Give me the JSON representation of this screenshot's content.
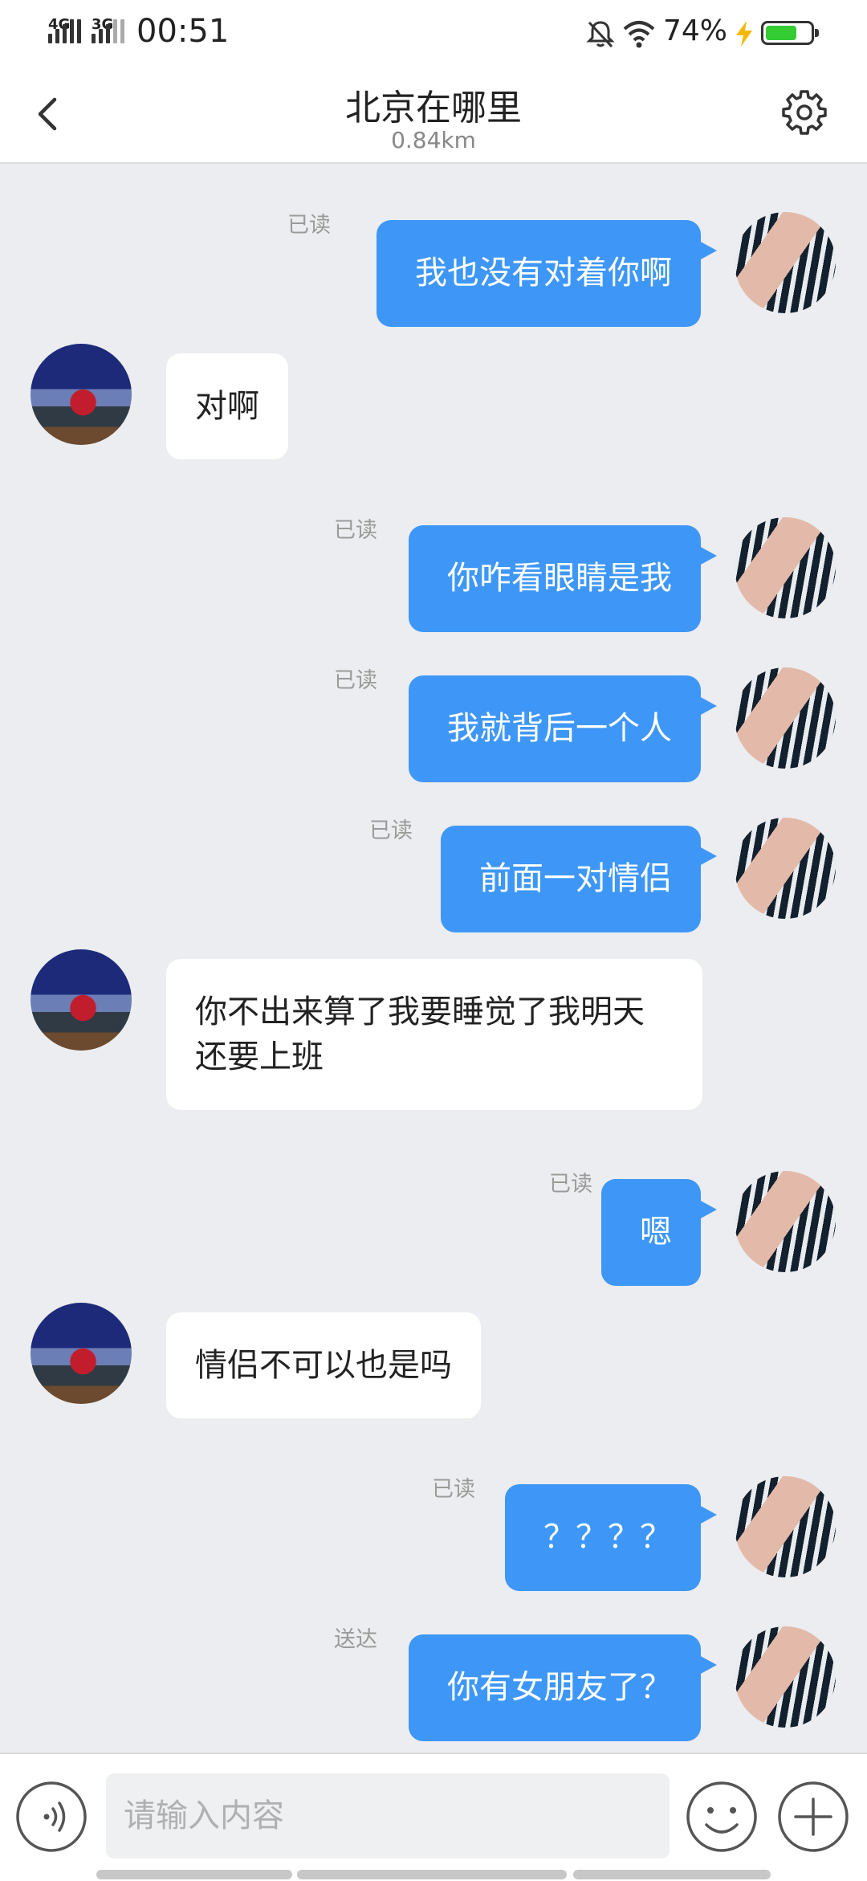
{
  "status_bar": {
    "network_1": "4G",
    "network_2": "3G",
    "time": "00:51",
    "battery_percent": "74%",
    "battery_level": 0.74,
    "icons": [
      "mute-icon",
      "wifi-icon",
      "charging-icon",
      "battery-icon"
    ]
  },
  "header": {
    "title": "北京在哪里",
    "distance": "0.84km",
    "back_icon": "chevron-left-icon",
    "settings_icon": "gear-icon"
  },
  "messages": [
    {
      "dir": "out",
      "text": "我也没有对着你啊",
      "receipt": "已读"
    },
    {
      "dir": "in",
      "text": "对啊"
    },
    {
      "dir": "out",
      "text": "你咋看眼睛是我",
      "receipt": "已读"
    },
    {
      "dir": "out",
      "text": "我就背后一个人",
      "receipt": "已读"
    },
    {
      "dir": "out",
      "text": "前面一对情侣",
      "receipt": "已读"
    },
    {
      "dir": "in",
      "text": "你不出来算了我要睡觉了我明天还要上班"
    },
    {
      "dir": "out",
      "text": "嗯",
      "receipt": "已读"
    },
    {
      "dir": "in",
      "text": "情侣不可以也是吗"
    },
    {
      "dir": "out",
      "text": "？？？？",
      "receipt": "已读"
    },
    {
      "dir": "out",
      "text": "你有女朋友了？",
      "receipt": "送达"
    }
  ],
  "input_bar": {
    "placeholder": "请输入内容",
    "value": "",
    "voice_icon": "voice-icon",
    "emoji_icon": "smiley-icon",
    "plus_icon": "plus-icon"
  },
  "colors": {
    "outgoing_bubble": "#3e97f7",
    "incoming_bubble": "#ffffff",
    "chat_background": "#ebedf0",
    "battery_fill": "#33cc33",
    "charging_bolt": "#f5b800"
  }
}
